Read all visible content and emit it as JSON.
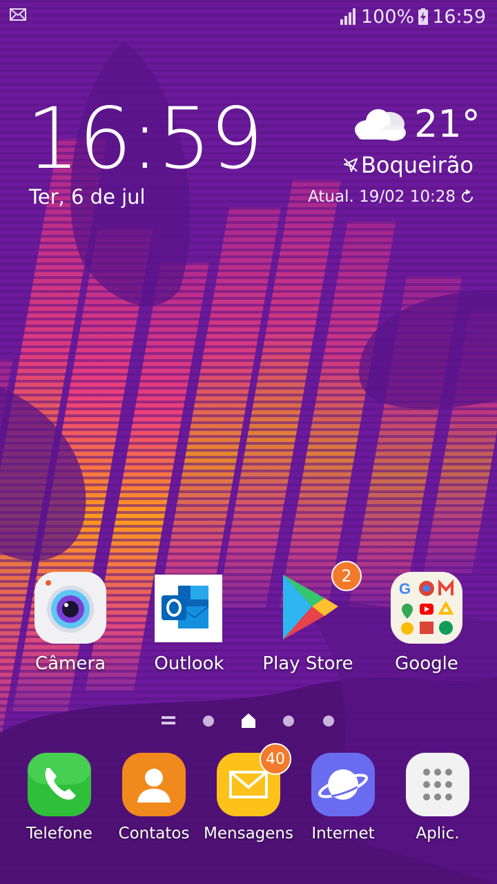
{
  "status_bar": {
    "battery": "100%",
    "time": "16:59",
    "icons": [
      "mail-icon",
      "signal-icon",
      "battery-charging-icon"
    ]
  },
  "clock_widget": {
    "time_hours": "16",
    "time_minutes": "59",
    "date": "Ter, 6 de jul"
  },
  "weather_widget": {
    "temperature": "21°",
    "location": "Boqueirão",
    "updated": "Atual. 19/02 10:28",
    "icons": [
      "cloudy-icon",
      "location-icon",
      "refresh-icon"
    ]
  },
  "home_apps": [
    {
      "label": "Câmera",
      "icon": "camera-icon"
    },
    {
      "label": "Outlook",
      "icon": "outlook-icon"
    },
    {
      "label": "Play Store",
      "icon": "play-store-icon",
      "badge": "2"
    },
    {
      "label": "Google",
      "icon": "google-folder-icon"
    }
  ],
  "page_indicators": {
    "pages": [
      "apps-list",
      "page-1",
      "home",
      "page-3",
      "page-4"
    ],
    "current": "home"
  },
  "dock_apps": [
    {
      "label": "Telefone",
      "icon": "phone-icon"
    },
    {
      "label": "Contatos",
      "icon": "contacts-icon"
    },
    {
      "label": "Mensagens",
      "icon": "messages-icon",
      "badge": "40"
    },
    {
      "label": "Internet",
      "icon": "internet-icon"
    },
    {
      "label": "Aplic.",
      "icon": "app-drawer-icon"
    }
  ],
  "colors": {
    "wallpaper_base": "#6a1a9a",
    "wallpaper_dark": "#4a1070",
    "stripe_orange": "#ff9a1c",
    "stripe_pink": "#ec3f7a",
    "badge": "#f27a2a"
  }
}
